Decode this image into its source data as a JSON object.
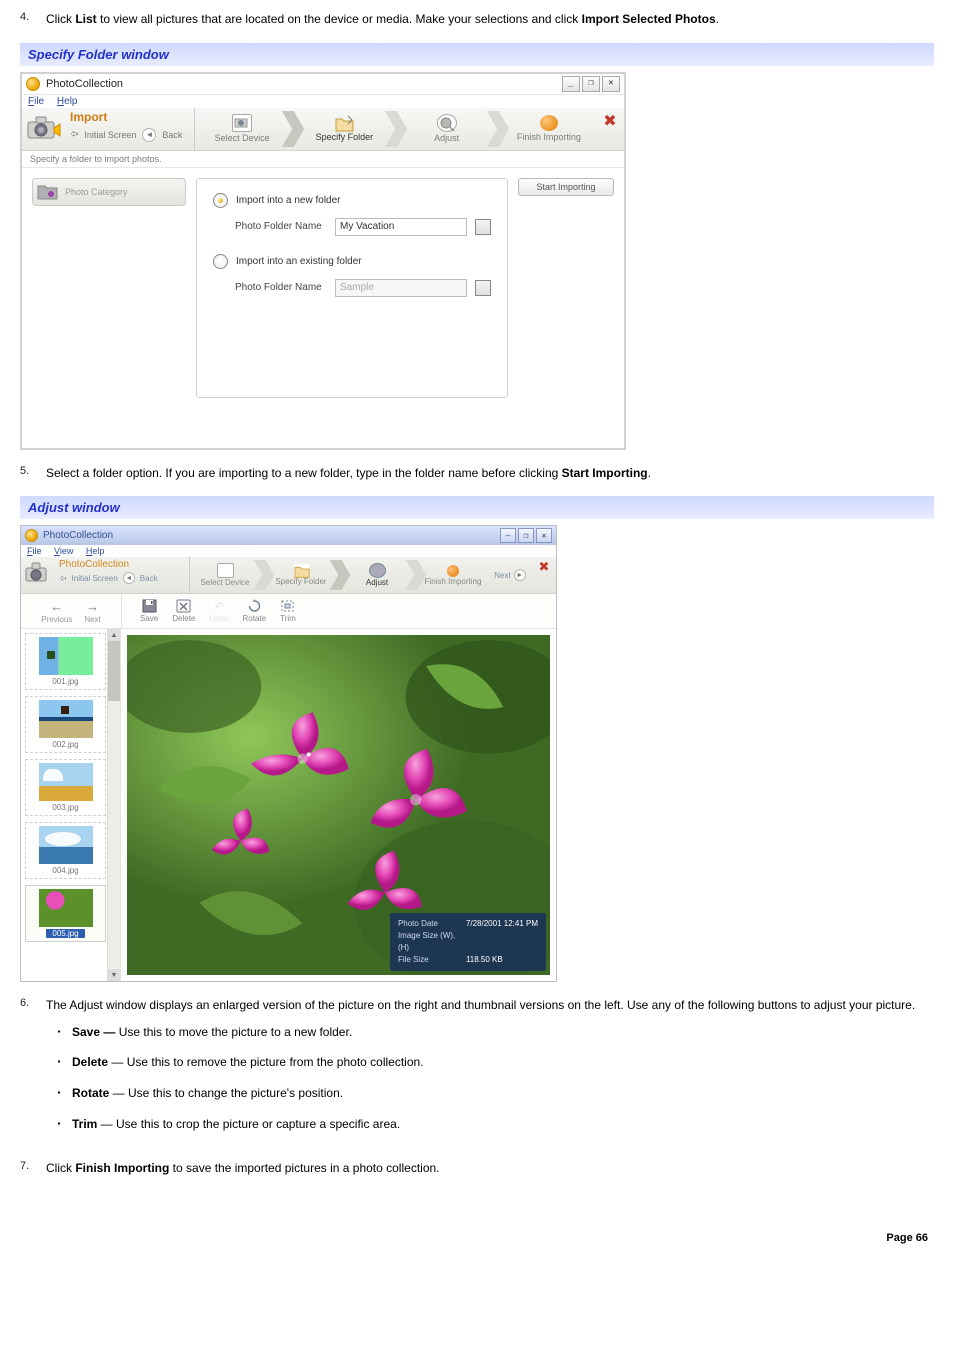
{
  "steps": {
    "s4": {
      "num": "4.",
      "text_before": "Click ",
      "bold1": "List",
      "text_mid": " to view all pictures that are located on the device or media. Make your selections and click ",
      "bold2": "Import Selected Photos",
      "text_after": "."
    },
    "s5": {
      "num": "5.",
      "text_before": "Select a folder option. If you are importing to a new folder, type in the folder name before clicking ",
      "bold1": "Start Importing",
      "text_after": "."
    },
    "s6": {
      "num": "6.",
      "text": "The Adjust window displays an enlarged version of the picture on the right and thumbnail versions on the left. Use any of the following buttons to adjust your picture.",
      "sub": [
        {
          "bold": "Save —",
          "text": " Use this to move the picture to a new folder."
        },
        {
          "bold": "Delete",
          "sep": " — ",
          "text": "Use this to remove the picture from the photo collection."
        },
        {
          "bold": "Rotate",
          "sep": " — ",
          "text": "Use this to change the picture's position."
        },
        {
          "bold": "Trim",
          "sep": " — ",
          "text": "Use this to crop the picture or capture a specific area."
        }
      ]
    },
    "s7": {
      "num": "7.",
      "text_before": "Click ",
      "bold1": "Finish Importing",
      "text_after": " to save the imported pictures in a photo collection."
    }
  },
  "headers": {
    "specify": "Specify Folder window",
    "adjust": "Adjust window"
  },
  "win1": {
    "title": "PhotoCollection",
    "menu": {
      "file": "File",
      "help": "Help"
    },
    "import": "Import",
    "initial": "Initial Screen",
    "back": "Back",
    "steps": {
      "select_device": "Select Device",
      "specify_folder": "Specify Folder",
      "adjust": "Adjust",
      "finish": "Finish Importing"
    },
    "hint": "Specify a folder to import photos.",
    "left_category": "Photo Category",
    "radio_new": "Import into a new folder",
    "radio_existing": "Import into an existing folder",
    "fld_label": "Photo Folder Name",
    "fld_value": "My Vacation",
    "fld_placeholder": "Sample",
    "start": "Start Importing",
    "winctrls": {
      "min": "_",
      "max": "❐",
      "close": "✕"
    }
  },
  "win2": {
    "title": "PhotoCollection",
    "menu": {
      "file": "File",
      "view": "View",
      "help": "Help"
    },
    "import": "PhotoCollection",
    "initial": "Initial Screen",
    "back": "Back",
    "steps": {
      "select_device": "Select Device",
      "specify_folder": "Specify Folder",
      "adjust": "Adjust",
      "finish": "Finish Importing"
    },
    "next": "Next",
    "nav": {
      "prev": "Previous",
      "next": "Next"
    },
    "tools": {
      "save": "Save",
      "delete": "Delete",
      "undo": "Undo",
      "rotate": "Rotate",
      "trim": "Trim"
    },
    "thumbs": [
      "001.jpg",
      "002.jpg",
      "003.jpg",
      "004.jpg",
      "005.jpg"
    ],
    "meta": {
      "date_k": "Photo Date",
      "date_v": "7/28/2001 12:41 PM",
      "size_k": "Image Size (W), (H)",
      "size_v": "",
      "file_k": "File Size",
      "file_v": "118.50 KB"
    },
    "winctrls": {
      "min": "–",
      "max": "❐",
      "close": "✕"
    }
  },
  "footer": "Page 66"
}
